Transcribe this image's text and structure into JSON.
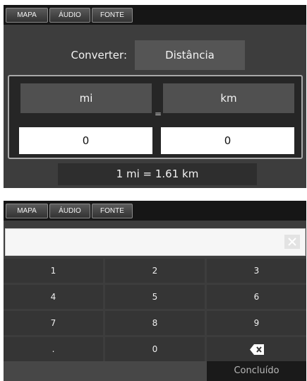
{
  "top_screen": {
    "tabs": [
      "MAPA",
      "ÁUDIO",
      "FONTE"
    ],
    "converter_label": "Converter:",
    "unit_type": "Distância",
    "units": {
      "left": "mi",
      "right": "km"
    },
    "equals": "=",
    "values": {
      "left": "0",
      "right": "0"
    },
    "ratio": "1 mi = 1.61 km"
  },
  "bottom_screen": {
    "tabs": [
      "MAPA",
      "ÁUDIO",
      "FONTE"
    ],
    "input_value": "",
    "keys": [
      "1",
      "2",
      "3",
      "4",
      "5",
      "6",
      "7",
      "8",
      "9",
      ".",
      "0"
    ],
    "backspace_icon": "backspace-icon",
    "clear_icon": "clear-x-icon",
    "done_label": "Concluído"
  }
}
